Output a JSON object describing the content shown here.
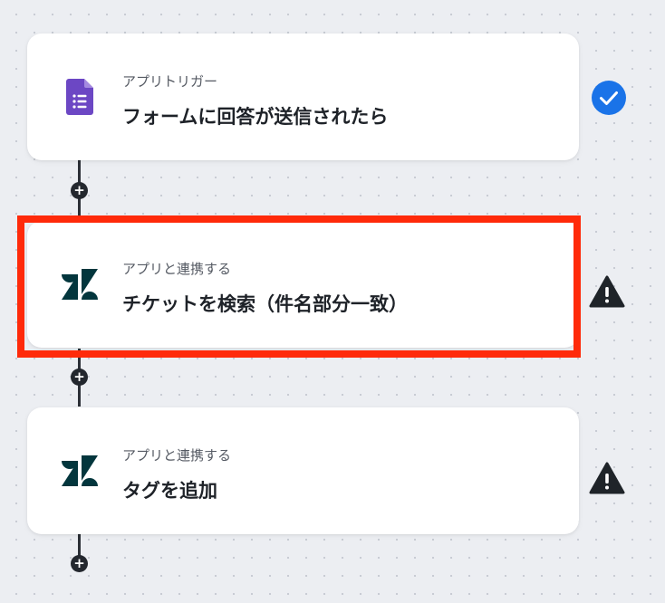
{
  "flow": {
    "steps": [
      {
        "type_label": "アプリトリガー",
        "title": "フォームに回答が送信されたら",
        "app_icon": "google-forms-icon",
        "status_icon": "check-icon",
        "status": "complete"
      },
      {
        "type_label": "アプリと連携する",
        "title": "チケットを検索（件名部分一致）",
        "app_icon": "zendesk-icon",
        "status_icon": "warning-icon",
        "status": "warning",
        "highlighted": true
      },
      {
        "type_label": "アプリと連携する",
        "title": "タグを追加",
        "app_icon": "zendesk-icon",
        "status_icon": "warning-icon",
        "status": "warning"
      }
    ],
    "add_step_symbol": "+"
  },
  "colors": {
    "check": "#1a73e8",
    "warning": "#1f2429",
    "highlight": "#ff2a0a",
    "forms": "#6c47c4",
    "zendesk": "#03363d"
  }
}
